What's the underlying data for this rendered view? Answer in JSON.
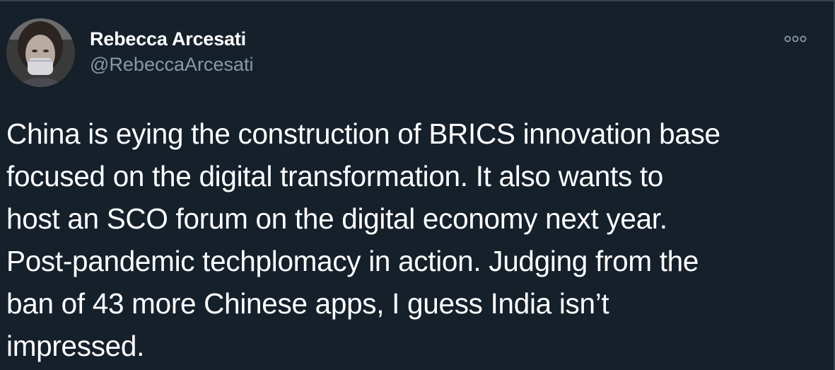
{
  "tweet": {
    "author": {
      "display_name": "Rebecca Arcesati",
      "handle": "@RebeccaArcesati",
      "avatar_icon": "user-avatar-photo"
    },
    "more_icon": "more-options-icon",
    "text": "China is eying the construction of BRICS innovation base\nfocused on the digital transformation. It also wants to\nhost an SCO forum on the digital economy next year.\nPost-pandemic techplomacy in action. Judging from the\nban of 43 more Chinese apps, I guess India isn’t\nimpressed."
  },
  "colors": {
    "background": "#15202b",
    "text_primary": "#ffffff",
    "text_secondary": "#8899a6",
    "border": "#38444d"
  }
}
